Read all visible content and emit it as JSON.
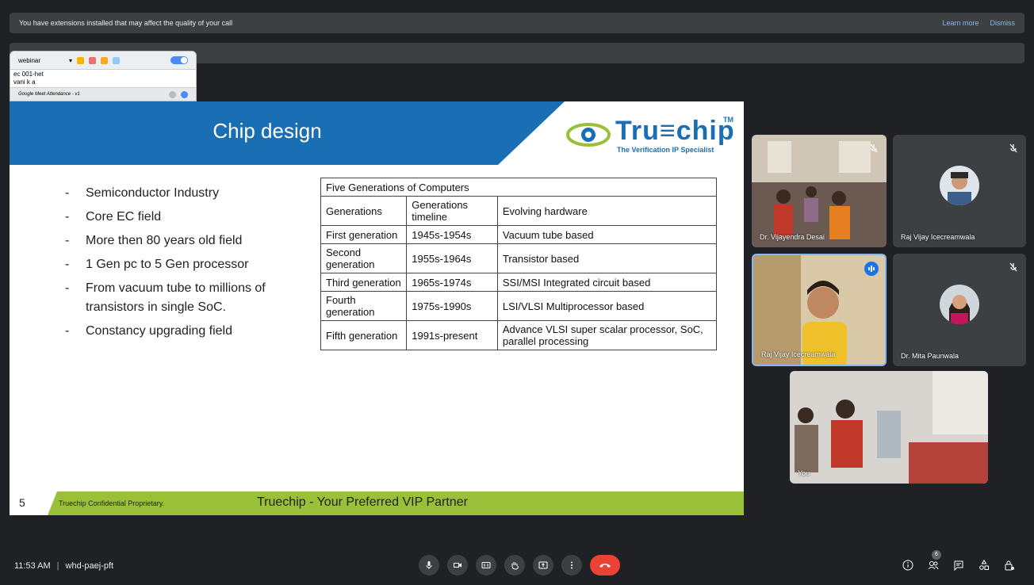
{
  "banner": {
    "message": "You have extensions installed that may affect the quality of your call",
    "learn_more": "Learn more",
    "dismiss": "Dismiss"
  },
  "extension": {
    "dropdown_value": "webinar",
    "list_items": [
      "ec 001-het",
      "vani k a"
    ],
    "footer": "Google Meet Attendance - v1"
  },
  "slide": {
    "title": "Chip design",
    "logo_word": "Tru≡chip",
    "logo_tm": "TM",
    "logo_tagline": "The Verification IP Specialist",
    "bullets": [
      "Semiconductor Industry",
      "Core EC field",
      "More then 80 years old field",
      "1 Gen pc to 5 Gen processor",
      "From vacuum tube to millions of transistors in single SoC.",
      "Constancy upgrading field"
    ],
    "table": {
      "caption": "Five Generations of Computers",
      "headers": [
        "Generations",
        "Generations timeline",
        "Evolving hardware"
      ],
      "rows": [
        [
          "First generation",
          "1945s-1954s",
          "Vacuum tube based"
        ],
        [
          "Second generation",
          "1955s-1964s",
          "Transistor based"
        ],
        [
          "Third generation",
          "1965s-1974s",
          "SSI/MSI Integrated circuit based"
        ],
        [
          "Fourth generation",
          "1975s-1990s",
          "LSI/VLSI Multiprocessor based"
        ],
        [
          "Fifth generation",
          "1991s-present",
          "Advance VLSI super scalar processor, SoC, parallel processing"
        ]
      ]
    },
    "page_number": "5",
    "confidential": "Truechip Confidential Proprietary.",
    "slogan": "Truechip - Your Preferred VIP Partner"
  },
  "participants": [
    {
      "name": "Dr. Vijayendra Desai",
      "muted": true
    },
    {
      "name": "Raj Vijay Icecreamwala",
      "muted": true
    },
    {
      "name": "Raj Vijay Icecreamwala",
      "speaking": true
    },
    {
      "name": "Dr. Mita Paunwala",
      "muted": true
    },
    {
      "name": "You"
    }
  ],
  "meeting": {
    "time": "11:53 AM",
    "code": "whd-paej-pft",
    "participant_count": "6"
  },
  "colors": {
    "background": "#202124",
    "end_call": "#ea4335",
    "slide_header": "#1a6fb4",
    "slide_footer": "#9ac03a",
    "active_speaker": "#1a73e8"
  }
}
